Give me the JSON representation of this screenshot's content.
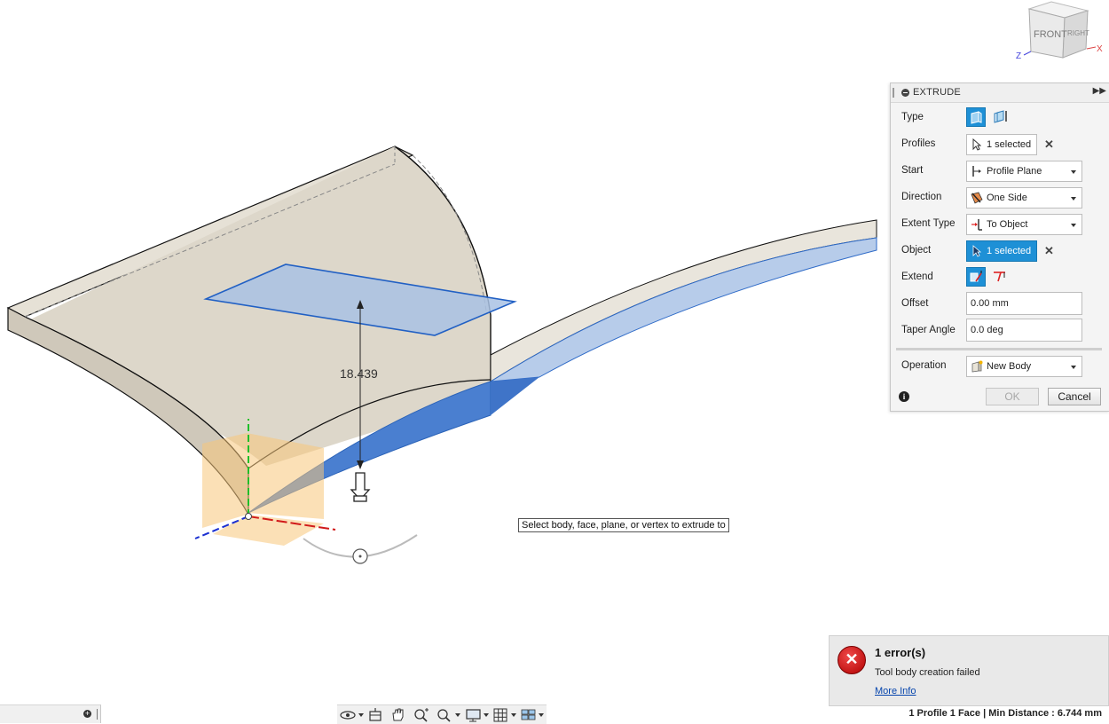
{
  "viewcube": {
    "front_label": "FRONT",
    "right_label": "RIGHT",
    "axis_x": "X",
    "axis_z": "Z"
  },
  "extrude": {
    "title": "EXTRUDE",
    "rows": {
      "type": {
        "label": "Type"
      },
      "profiles": {
        "label": "Profiles",
        "value": "1 selected"
      },
      "start": {
        "label": "Start",
        "value": "Profile Plane"
      },
      "direction": {
        "label": "Direction",
        "value": "One Side"
      },
      "extent_type": {
        "label": "Extent Type",
        "value": "To Object"
      },
      "object": {
        "label": "Object",
        "value": "1 selected"
      },
      "extend": {
        "label": "Extend"
      },
      "offset": {
        "label": "Offset",
        "value": "0.00 mm"
      },
      "taper_angle": {
        "label": "Taper Angle",
        "value": "0.0 deg"
      },
      "operation": {
        "label": "Operation",
        "value": "New Body"
      }
    },
    "ok_label": "OK",
    "cancel_label": "Cancel"
  },
  "canvas": {
    "dimension_value": "18.439",
    "tooltip": "Select body, face, plane, or vertex to extrude to"
  },
  "error": {
    "title": "1 error(s)",
    "message": "Tool body creation failed",
    "link": "More Info"
  },
  "status": {
    "text": "1 Profile 1 Face | Min Distance : 6.744 mm"
  },
  "colors": {
    "accent": "#1e90d6",
    "body_face": "#e2ddd2",
    "selected_face": "#4a7fd0",
    "sketch_profile": "#a9c2e4",
    "error_red": "#c41212",
    "axis_x": "#d11a1a",
    "axis_y": "#1fbf2a",
    "axis_z": "#1a2fd1"
  }
}
